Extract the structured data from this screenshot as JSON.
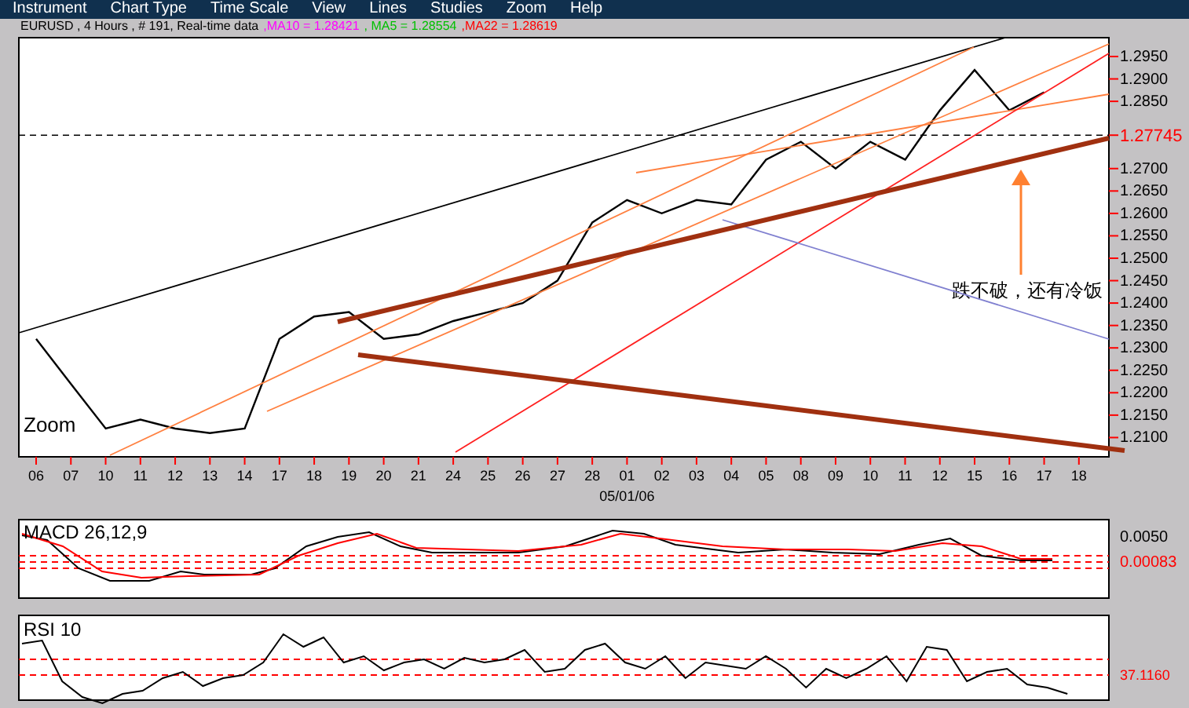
{
  "menu": [
    "Instrument",
    "Chart Type",
    "Time Scale",
    "View",
    "Lines",
    "Studies",
    "Zoom",
    "Help"
  ],
  "header": {
    "info": "EURUSD , 4 Hours , # 191, Real-time data",
    "indicators": [
      {
        "label": ",MA10 = 1.28421",
        "color": "#ff00ff"
      },
      {
        "label": ", MA5 = 1.28554",
        "color": "#00c000"
      },
      {
        "label": ",MA22 = 1.28619",
        "color": "#ff0000"
      }
    ]
  },
  "price_chart": {
    "zoom_label": "Zoom",
    "chart_data": {
      "type": "line",
      "xlabel": "05/01/06",
      "categories": [
        "06",
        "07",
        "10",
        "11",
        "12",
        "13",
        "14",
        "17",
        "18",
        "19",
        "20",
        "21",
        "24",
        "25",
        "26",
        "27",
        "28",
        "01",
        "02",
        "03",
        "04",
        "05",
        "08",
        "09",
        "10",
        "11",
        "12",
        "15",
        "16",
        "17",
        "18"
      ],
      "series": [
        {
          "color": "#000000",
          "values": [
            1.232,
            1.222,
            1.212,
            1.214,
            1.212,
            1.211,
            1.212,
            1.232,
            1.237,
            1.238,
            1.232,
            1.233,
            1.236,
            1.238,
            1.24,
            1.245,
            1.258,
            1.263,
            1.26,
            1.263,
            1.262,
            1.272,
            1.276,
            1.27,
            1.276,
            1.272,
            1.283,
            1.292,
            1.283,
            1.287,
            null
          ]
        }
      ],
      "ylim": [
        1.2057,
        1.2992
      ],
      "yticks": [
        {
          "value": 1.21,
          "label": "1.2100"
        },
        {
          "value": 1.215,
          "label": "1.2150"
        },
        {
          "value": 1.22,
          "label": "1.2200"
        },
        {
          "value": 1.225,
          "label": "1.2250"
        },
        {
          "value": 1.23,
          "label": "1.2300"
        },
        {
          "value": 1.235,
          "label": "1.2350"
        },
        {
          "value": 1.24,
          "label": "1.2400"
        },
        {
          "value": 1.245,
          "label": "1.2450"
        },
        {
          "value": 1.25,
          "label": "1.2500"
        },
        {
          "value": 1.255,
          "label": "1.2550"
        },
        {
          "value": 1.26,
          "label": "1.2600"
        },
        {
          "value": 1.265,
          "label": "1.2650"
        },
        {
          "value": 1.27,
          "label": "1.2700"
        },
        {
          "value": 1.285,
          "label": "1.2850"
        },
        {
          "value": 1.29,
          "label": "1.2900"
        },
        {
          "value": 1.295,
          "label": "1.2950"
        }
      ],
      "ref_lines": [
        {
          "axis": "y",
          "value": 1.27745,
          "label": "1.27745"
        }
      ],
      "annotations": [
        "跌不破，还有冷饭"
      ]
    }
  },
  "macd": {
    "title": "MACD 26,12,9",
    "labels": [
      "0.0050",
      "0.00083"
    ]
  },
  "rsi": {
    "title": "RSI 10",
    "label": "37.1160"
  }
}
